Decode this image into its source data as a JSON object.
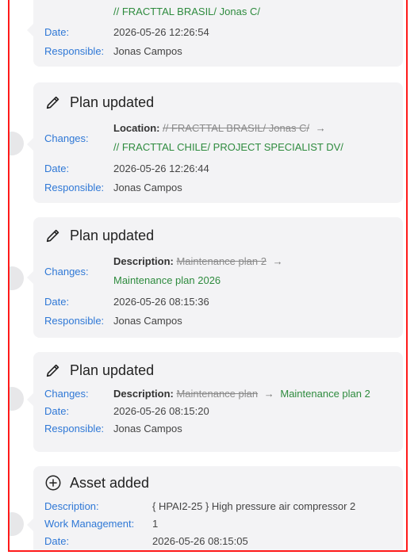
{
  "labels": {
    "date": "Date:",
    "responsible": "Responsible:",
    "changes": "Changes:",
    "description": "Description:",
    "work_management": "Work Management:"
  },
  "card0": {
    "location_tail": "// FRACTTAL BRASIL/ Jonas C/",
    "date": "2026-05-26 12:26:54",
    "responsible": "Jonas Campos"
  },
  "card1": {
    "title": "Plan updated",
    "field": "Location:",
    "old": "// FRACTTAL BRASIL/ Jonas C/",
    "arrow": "→",
    "new": "// FRACTTAL CHILE/ PROJECT SPECIALIST DV/",
    "date": "2026-05-26 12:26:44",
    "responsible": "Jonas Campos"
  },
  "card2": {
    "title": "Plan updated",
    "field": "Description:",
    "old": "Maintenance plan 2",
    "arrow": "→",
    "new": "Maintenance plan 2026",
    "date": "2026-05-26 08:15:36",
    "responsible": "Jonas Campos"
  },
  "card3": {
    "title": "Plan updated",
    "field": "Description:",
    "old": "Maintenance plan",
    "arrow": "→",
    "new": "Maintenance plan 2",
    "date": "2026-05-26 08:15:20",
    "responsible": "Jonas Campos"
  },
  "card4": {
    "title": "Asset added",
    "description": "{ HPAI2-25 } High pressure air compressor 2",
    "work_management": "1",
    "date": "2026-05-26 08:15:05"
  },
  "icons": {
    "edit": "pencil-icon",
    "add": "plus-circle-icon"
  }
}
